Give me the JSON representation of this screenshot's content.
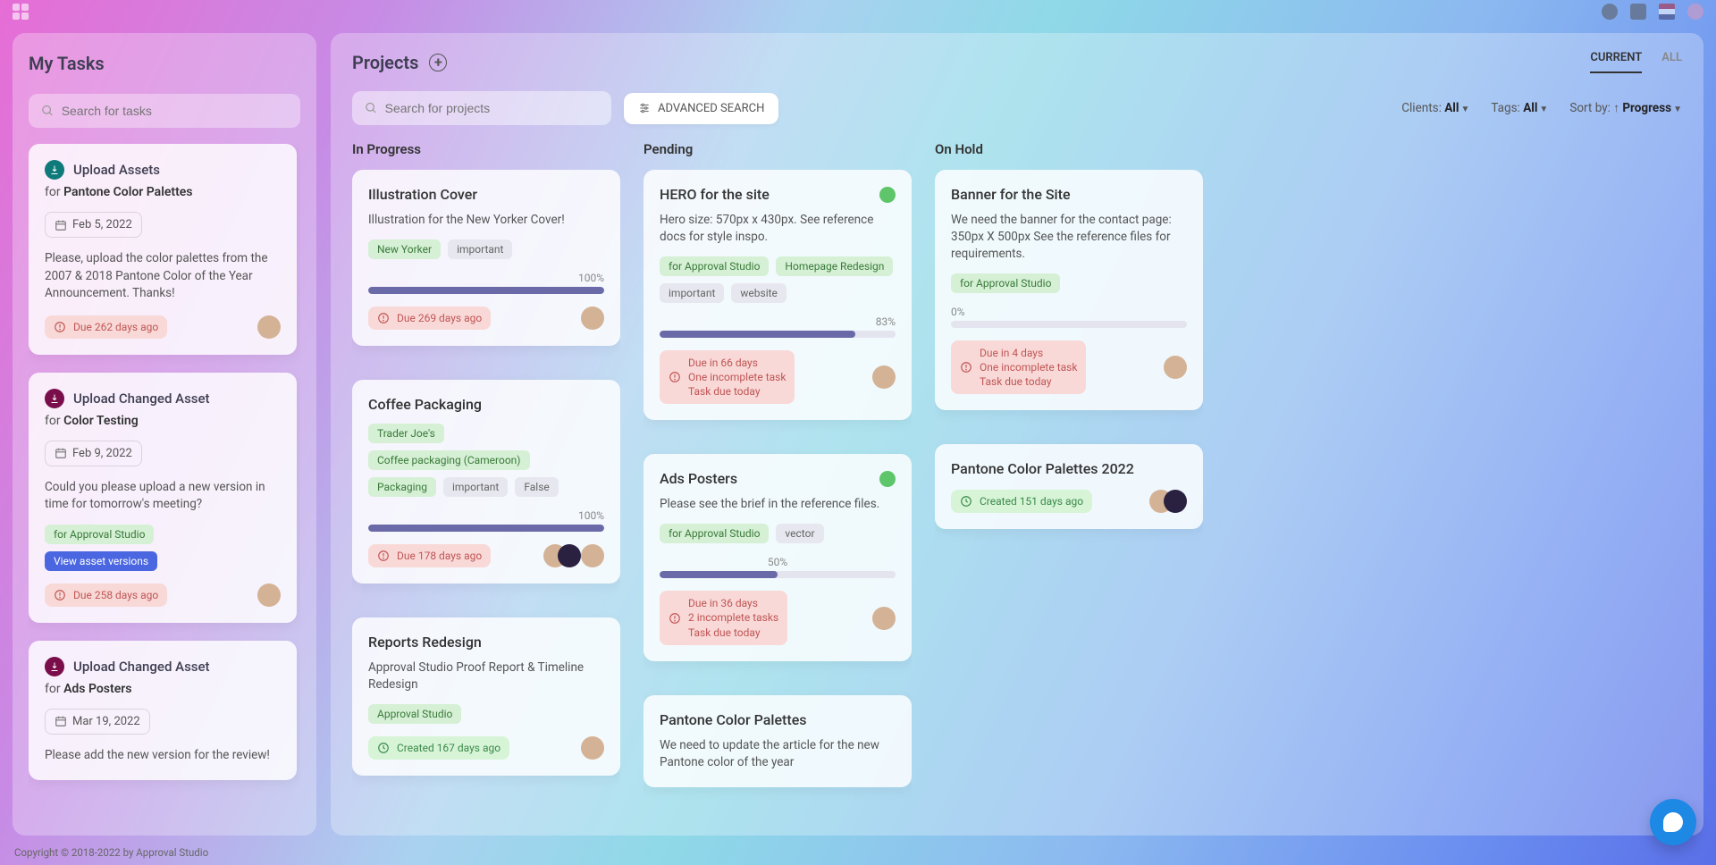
{
  "sidebar": {
    "title": "My Tasks",
    "search_placeholder": "Search for tasks",
    "tasks": [
      {
        "icon": "teal",
        "action": "Upload Assets",
        "for_prefix": "for ",
        "for": "Pantone Color Palettes",
        "date": "Feb 5, 2022",
        "desc": "Please, upload the color palettes from the 2007 & 2018 Pantone Color of the Year Announcement. Thanks!",
        "due": "Due 262 days ago"
      },
      {
        "icon": "mag",
        "action": "Upload Changed Asset",
        "for_prefix": "for ",
        "for": "Color Testing",
        "date": "Feb 9, 2022",
        "desc": "Could you please upload a new version in time for tomorrow's meeting?",
        "tag_green": "for Approval Studio",
        "tag_blue": "View asset versions",
        "due": "Due 258 days ago"
      },
      {
        "icon": "mag",
        "action": "Upload Changed Asset",
        "for_prefix": "for ",
        "for": "Ads Posters",
        "date": "Mar 19, 2022",
        "desc": "Please add the new version for the review!"
      }
    ]
  },
  "main": {
    "title": "Projects",
    "tabs": {
      "current": "CURRENT",
      "all": "ALL"
    },
    "search_placeholder": "Search for projects",
    "advanced": "ADVANCED SEARCH",
    "filters": {
      "clients_label": "Clients:",
      "clients_value": "All",
      "tags_label": "Tags:",
      "tags_value": "All",
      "sort_label": "Sort by:",
      "sort_value": "Progress"
    },
    "columns": {
      "in_progress": {
        "title": "In Progress",
        "projects": [
          {
            "title": "Illustration Cover",
            "desc": "Illustration for the New Yorker Cover!",
            "tags_green": [
              "New Yorker"
            ],
            "tags_grey": [
              "important"
            ],
            "progress": 100,
            "progress_label": "100%",
            "due": "Due 269 days ago",
            "avatars": 1
          },
          {
            "title": "Coffee Packaging",
            "desc": "",
            "tags_green": [
              "Trader Joe's",
              "Coffee packaging (Cameroon)",
              "Packaging"
            ],
            "tags_grey": [
              "important",
              "False"
            ],
            "progress": 100,
            "progress_label": "100%",
            "due": "Due 178 days ago",
            "avatars": 2
          },
          {
            "title": "Reports Redesign",
            "desc": "Approval Studio Proof Report & Timeline Redesign",
            "tags_green": [
              "Approval Studio"
            ],
            "tags_grey": [],
            "created": "Created 167 days ago",
            "avatars": 1
          }
        ]
      },
      "pending": {
        "title": "Pending",
        "projects": [
          {
            "title": "HERO for the site",
            "dot": true,
            "desc": "Hero size: 570px x 430px. See reference docs for style inspo.",
            "tags_green": [
              "for Approval Studio",
              "Homepage Redesign"
            ],
            "tags_grey": [
              "important",
              "website"
            ],
            "progress": 83,
            "progress_label": "83%",
            "due_lines": [
              "Due in 66 days",
              "One incomplete task",
              "Task due today"
            ],
            "avatars": 1
          },
          {
            "title": "Ads Posters",
            "dot": true,
            "desc": "Please see the brief in the reference files.",
            "tags_green": [
              "for Approval Studio"
            ],
            "tags_grey": [
              "vector"
            ],
            "progress": 50,
            "progress_label": "50%",
            "progress_center": true,
            "due_lines": [
              "Due in 36 days",
              "2 incomplete tasks",
              "Task due today"
            ],
            "avatars": 1
          },
          {
            "title": "Pantone Color Palettes",
            "desc": "We need to update the article for the new Pantone color of the year"
          }
        ]
      },
      "on_hold": {
        "title": "On Hold",
        "projects": [
          {
            "title": "Banner for the Site",
            "desc": "We need the banner for the contact page: 350px X 500px See the reference files for requirements.",
            "tags_green": [
              "for Approval Studio"
            ],
            "tags_grey": [],
            "progress": 0,
            "progress_label": "0%",
            "progress_left": true,
            "due_lines": [
              "Due in 4 days",
              "One incomplete task",
              "Task due today"
            ],
            "avatars": 1
          },
          {
            "title": "Pantone Color Palettes 2022",
            "created": "Created 151 days ago",
            "avatars": 2
          }
        ]
      }
    }
  },
  "footer": "Copyright © 2018-2022 by Approval Studio"
}
